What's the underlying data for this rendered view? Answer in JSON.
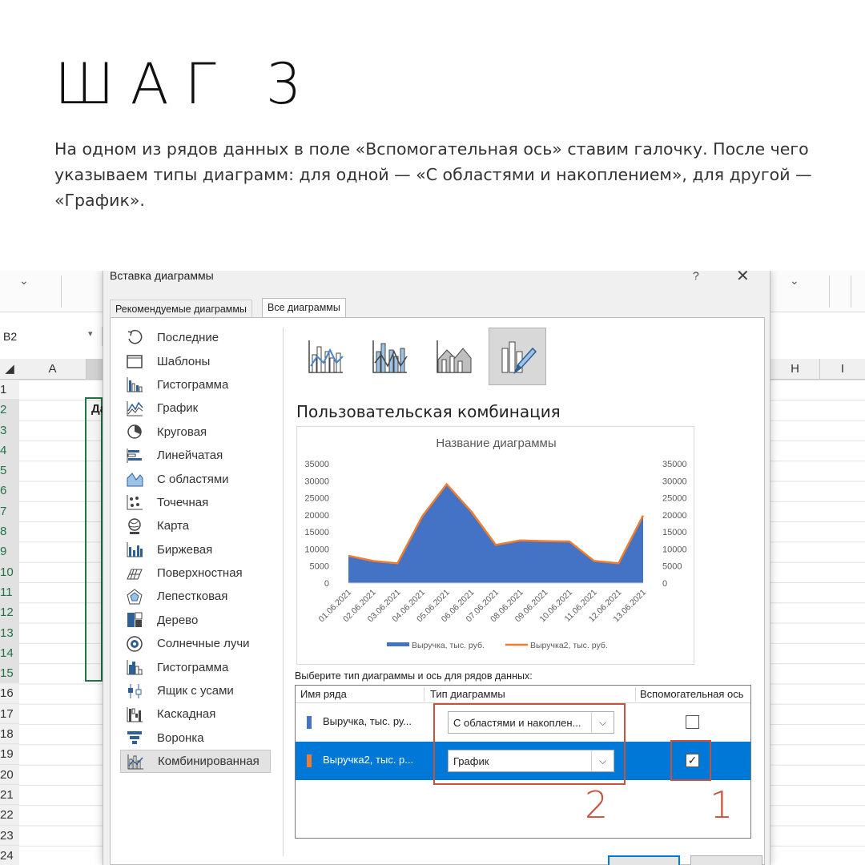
{
  "header": {
    "title": "ШАГ 3",
    "text": "На одном из рядов данных в поле «Вспомогательная ось» ставим галочку. После чего указываем типы диаграмм: для одной — «С областями и накоплением», для другой — «График»."
  },
  "excel": {
    "namebox": "B2",
    "col_a": "A",
    "col_h": "H",
    "col_i": "I",
    "rows": [
      "1",
      "2",
      "3",
      "4",
      "5",
      "6",
      "7",
      "8",
      "9",
      "10",
      "11",
      "12",
      "13",
      "14",
      "15",
      "16",
      "17",
      "18",
      "19",
      "20",
      "21",
      "22",
      "23",
      "24"
    ],
    "cell_b2": "Да"
  },
  "dialog": {
    "title": "Вставка диаграммы",
    "help": "?",
    "close": "✕",
    "tabs": [
      "Рекомендуемые диаграммы",
      "Все диаграммы"
    ],
    "chart_types": [
      {
        "label": "Последние",
        "icon": "recent-icon"
      },
      {
        "label": "Шаблоны",
        "icon": "folder-icon"
      },
      {
        "label": "Гистограмма",
        "icon": "column-chart-icon"
      },
      {
        "label": "График",
        "icon": "line-chart-icon"
      },
      {
        "label": "Круговая",
        "icon": "pie-chart-icon"
      },
      {
        "label": "Линейчатая",
        "icon": "bar-chart-icon"
      },
      {
        "label": "С областями",
        "icon": "area-chart-icon"
      },
      {
        "label": "Точечная",
        "icon": "scatter-chart-icon"
      },
      {
        "label": "Карта",
        "icon": "map-chart-icon"
      },
      {
        "label": "Биржевая",
        "icon": "stock-chart-icon"
      },
      {
        "label": "Поверхностная",
        "icon": "surface-chart-icon"
      },
      {
        "label": "Лепестковая",
        "icon": "radar-chart-icon"
      },
      {
        "label": "Дерево",
        "icon": "treemap-icon"
      },
      {
        "label": "Солнечные лучи",
        "icon": "sunburst-icon"
      },
      {
        "label": "Гистограмма",
        "icon": "histogram-icon"
      },
      {
        "label": "Ящик с усами",
        "icon": "box-whisker-icon"
      },
      {
        "label": "Каскадная",
        "icon": "waterfall-icon"
      },
      {
        "label": "Воронка",
        "icon": "funnel-icon"
      },
      {
        "label": "Комбинированная",
        "icon": "combo-chart-icon"
      }
    ],
    "selected_type_index": 18,
    "combo_heading": "Пользовательская комбинация",
    "choose_label": "Выберите тип диаграммы и ось для рядов данных:",
    "table_headers": {
      "series_name": "Имя ряда",
      "chart_type": "Тип диаграммы",
      "secondary_axis": "Вспомогательная ось"
    },
    "series_rows": [
      {
        "name": "Выручка, тыс. ру...",
        "type": "С областями и накоплен...",
        "secondary": false,
        "color": "#4472c4"
      },
      {
        "name": "Выручка2, тыс. р...",
        "type": "График",
        "secondary": true,
        "color": "#ed7d31"
      }
    ],
    "chevron": "⌵",
    "checkmark": "✓"
  },
  "annotations": {
    "one": "1",
    "two": "2",
    "color": "#c8533c"
  },
  "chart_data": {
    "type": "area",
    "title": "Название диаграммы",
    "categories": [
      "01.06.2021",
      "02.06.2021",
      "03.06.2021",
      "04.06.2021",
      "05.06.2021",
      "06.06.2021",
      "07.06.2021",
      "08.06.2021",
      "09.06.2021",
      "10.06.2021",
      "11.06.2021",
      "12.06.2021",
      "13.06.2021"
    ],
    "series": [
      {
        "name": "Выручка, тыс. руб.",
        "type": "area",
        "axis": "primary",
        "color": "#4472c4",
        "values": [
          8000,
          6500,
          5800,
          19500,
          29000,
          21000,
          11200,
          12500,
          12300,
          12200,
          6500,
          5800,
          19800
        ]
      },
      {
        "name": "Выручка2, тыс. руб.",
        "type": "line",
        "axis": "secondary",
        "color": "#ed7d31",
        "values": [
          8000,
          6500,
          5800,
          19500,
          29000,
          21000,
          11200,
          12500,
          12300,
          12200,
          6500,
          5800,
          19800
        ]
      }
    ],
    "ylim": [
      0,
      35000
    ],
    "yticks": [
      "35000",
      "30000",
      "25000",
      "20000",
      "15000",
      "10000",
      "5000",
      "0"
    ],
    "y2ticks": [
      "35000",
      "30000",
      "25000",
      "20000",
      "15000",
      "10000",
      "5000",
      "0"
    ],
    "legend": "bottom",
    "grid": false
  }
}
